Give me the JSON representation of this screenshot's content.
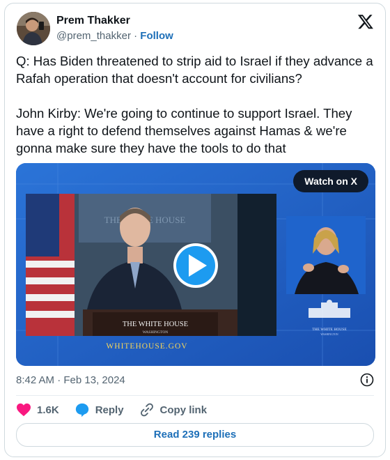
{
  "author": {
    "name": "Prem Thakker",
    "handle": "@prem_thakker",
    "separator": "·",
    "follow_label": "Follow"
  },
  "post": {
    "paragraphs": [
      "Q: Has Biden threatened to strip aid to Israel if they advance a Rafah operation that doesn't account for civilians?",
      "John Kirby: We're going to continue to support Israel. They have a right to defend themselves against Hamas & we're gonna make sure they have the tools to do that"
    ],
    "timestamp": "8:42 AM · Feb 13, 2024"
  },
  "media": {
    "watch_label": "Watch on X",
    "backdrop_text": "THE WHITE HOUSE",
    "podium_title": "THE WHITE HOUSE",
    "podium_subtitle": "WASHINGTON",
    "banner_url": "WHITEHOUSE.GOV",
    "logo_title": "THE WHITE HOUSE",
    "logo_subtitle": "WASHINGTON"
  },
  "actions": {
    "likes": "1.6K",
    "reply_label": "Reply",
    "copy_label": "Copy link",
    "read_replies_label": "Read 239 replies"
  },
  "colors": {
    "accent": "#1d6fb8",
    "like": "#f91880",
    "muted": "#536471",
    "media_blue": "#1e5fc7"
  }
}
